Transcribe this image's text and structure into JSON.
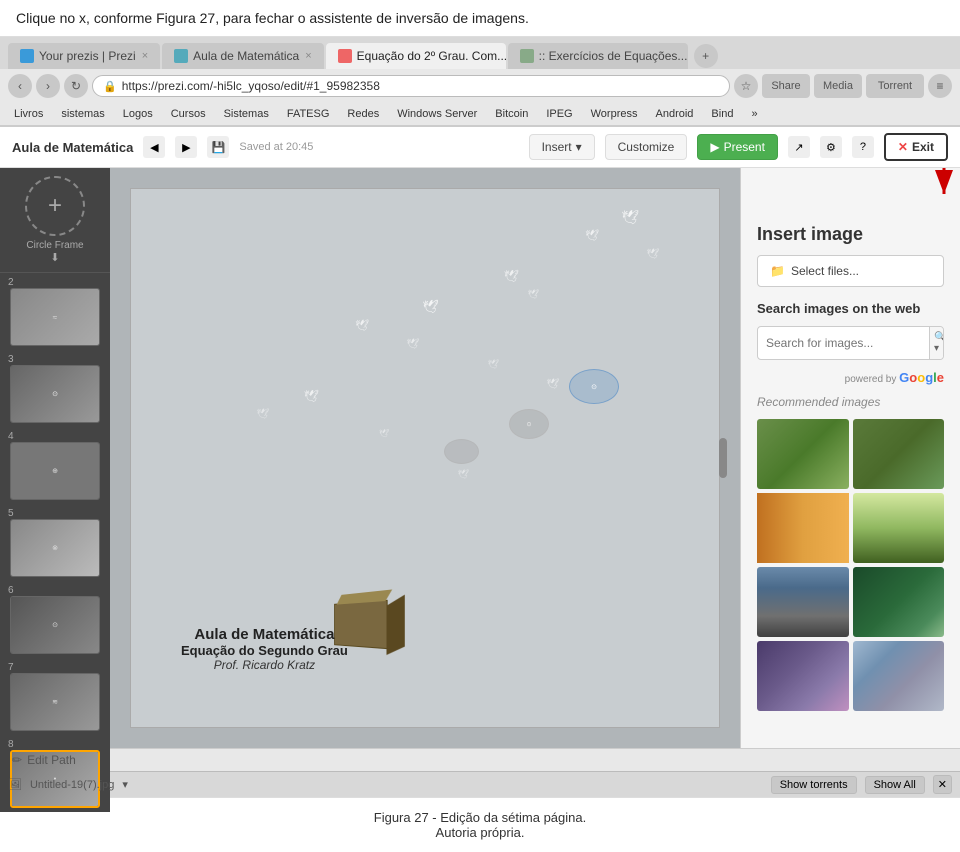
{
  "instruction": "Clique no x, conforme Figura 27, para fechar o assistente de inversão de imagens.",
  "browser": {
    "tabs": [
      {
        "id": "tab1",
        "label": "Your prezis | Prezi",
        "active": false
      },
      {
        "id": "tab2",
        "label": "Aula de Matemática",
        "active": false
      },
      {
        "id": "tab3",
        "label": "Equação do 2º Grau. Com...",
        "active": true
      },
      {
        "id": "tab4",
        "label": ":: Exercícios de Equações...",
        "active": false
      }
    ],
    "url": "https://prezi.com/-hi5lc_yqoso/edit/#1_95982358",
    "bookmarks": [
      "Livros",
      "sistemas",
      "Logos",
      "Cursos",
      "Sistemas",
      "FATESG",
      "Redes",
      "Windows Server",
      "Bitcoin",
      "IPEG",
      "Worpress",
      "Android",
      "Bind"
    ]
  },
  "prezi_topbar": {
    "title": "Aula de Matemática",
    "save_label": "Saved at 20:45",
    "insert_label": "Insert",
    "customize_label": "Customize",
    "present_label": "Present",
    "exit_label": "Exit"
  },
  "canvas": {
    "text1": "Aula de Matemática",
    "text2": "Equação do Segundo Grau",
    "author": "Prof. Ricardo Kratz"
  },
  "right_panel": {
    "title": "Insert image",
    "select_files_label": "Select files...",
    "search_section_label": "Search images on the web",
    "search_placeholder": "Search for images...",
    "powered_by_label": "powered by",
    "recommended_label": "Recommended images"
  },
  "bottom_bar": {
    "edit_path_label": "Edit Path",
    "file_label": "Untitled-19(7).jpg",
    "show_torrents_label": "Show torrents",
    "show_all_label": "Show All"
  },
  "caption": {
    "line1": "Figura 27 - Edição da sétima página.",
    "line2": "Autoria própria."
  },
  "slides": [
    {
      "num": "2",
      "type": "gray"
    },
    {
      "num": "3",
      "type": "content"
    },
    {
      "num": "4",
      "type": "gray"
    },
    {
      "num": "5",
      "type": "gray"
    },
    {
      "num": "6",
      "type": "content"
    },
    {
      "num": "7",
      "type": "gray"
    },
    {
      "num": "8",
      "type": "selected"
    }
  ]
}
